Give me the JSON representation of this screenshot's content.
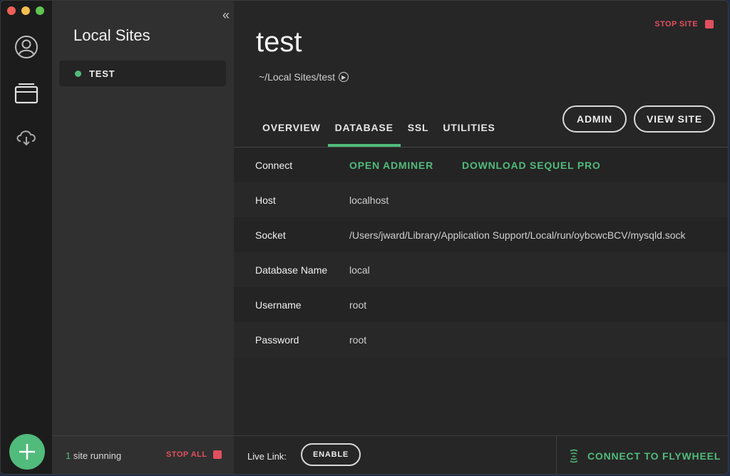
{
  "window": {
    "traffic_lights": [
      "#ee5f57",
      "#f4be4f",
      "#5fc553"
    ]
  },
  "rail": {
    "icons": [
      "user-icon",
      "sites-icon",
      "cloud-icon"
    ],
    "add_button_label": "+"
  },
  "sites_panel": {
    "title": "Local Sites",
    "collapse_glyph": "«",
    "sites": [
      {
        "name": "TEST",
        "status": "running",
        "status_color": "#51bb7b"
      }
    ],
    "footer": {
      "running_count": "1",
      "running_text": " site running",
      "stop_all_label": "STOP ALL"
    }
  },
  "main": {
    "stop_site_label": "STOP SITE",
    "site_title": "test",
    "site_path": "~/Local Sites/test",
    "tabs": [
      {
        "label": "OVERVIEW",
        "active": false
      },
      {
        "label": "DATABASE",
        "active": true
      },
      {
        "label": "SSL",
        "active": false
      },
      {
        "label": "UTILITIES",
        "active": false
      }
    ],
    "buttons": {
      "admin": "ADMIN",
      "view_site": "VIEW SITE"
    },
    "database": {
      "connect_label": "Connect",
      "open_adminer": "OPEN ADMINER",
      "download_sequel_pro": "DOWNLOAD SEQUEL PRO",
      "rows": [
        {
          "label": "Host",
          "value": "localhost"
        },
        {
          "label": "Socket",
          "value": "/Users/jward/Library/Application Support/Local/run/oybcwcBCV/mysqld.sock"
        },
        {
          "label": "Database Name",
          "value": "local"
        },
        {
          "label": "Username",
          "value": "root"
        },
        {
          "label": "Password",
          "value": "root"
        }
      ]
    },
    "footer": {
      "live_link_label": "Live Link:",
      "enable_label": "ENABLE",
      "flywheel_label": "CONNECT TO FLYWHEEL"
    }
  },
  "colors": {
    "accent_green": "#51bb7b",
    "stop_red": "#e0505e"
  }
}
